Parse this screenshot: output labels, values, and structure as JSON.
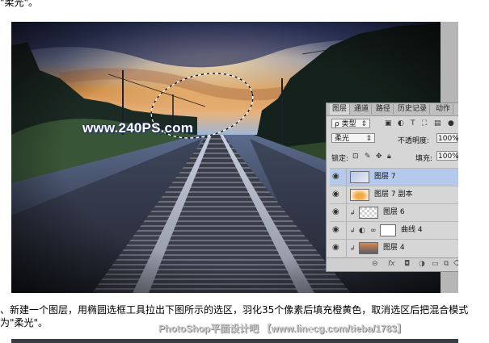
{
  "top_text": "\"柔光\"。",
  "photo": {
    "watermark": "www.240PS.com"
  },
  "layers_panel": {
    "tabs": [
      "图层",
      "通道",
      "路径",
      "历史记录",
      "动作"
    ],
    "filter_label": "ρ 类型",
    "blend_mode": "柔光",
    "opacity_label": "不透明度:",
    "opacity_value": "100%",
    "lock_label": "锁定:",
    "fill_label": "填充:",
    "fill_value": "100%",
    "layers": [
      {
        "name": "图层 7",
        "selected": true
      },
      {
        "name": "图层 7 副本",
        "selected": false
      },
      {
        "name": "图层 6",
        "selected": false
      },
      {
        "name": "曲线 4",
        "selected": false
      },
      {
        "name": "图层 4",
        "selected": false
      }
    ],
    "footer_icons": [
      "link-icon",
      "fx-icon",
      "mask-icon",
      "adjustment-icon",
      "folder-icon",
      "new-layer-icon",
      "trash-icon"
    ]
  },
  "caption": {
    "line1": "、新建一个图层，用椭圆选框工具拉出下图所示的选区，羽化35个像素后填充橙黄色，取消选区后把混合模式",
    "line2": "为\"柔光\"。"
  },
  "bottom_watermark": "PhotoShop平面设计吧 【www.lin℮cg.com/tieba/1783】",
  "colors": {
    "sky_orange": "#e0913e",
    "sky_blue": "#6c86b8",
    "selected_layer": "#b5c9ec"
  }
}
